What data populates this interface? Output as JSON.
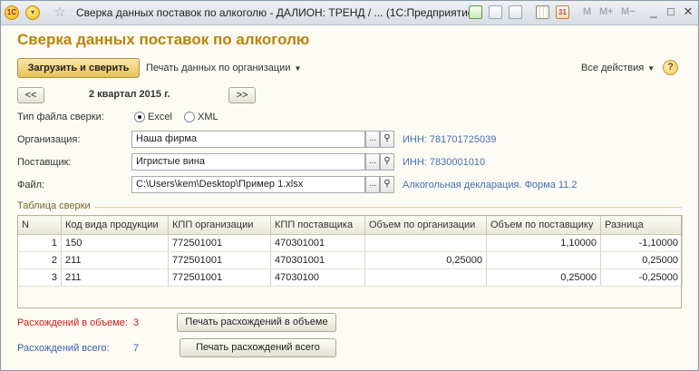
{
  "titlebar": {
    "title": "Сверка данных поставок по алкоголю - ДАЛИОН: ТРЕНД / ... (1С:Предприятие)",
    "logo": "1С",
    "m_labels": [
      "M",
      "M+",
      "M−"
    ]
  },
  "form": {
    "title": "Сверка данных поставок по алкоголю",
    "load_button": "Загрузить и сверить",
    "print_org_menu": "Печать данных по организации",
    "all_actions": "Все действия",
    "help": "?",
    "period": "2 квартал 2015 г.",
    "prev": "<<",
    "next": ">>"
  },
  "fields": {
    "file_type_label": "Тип файла сверки:",
    "radio_excel": "Excel",
    "radio_xml": "XML",
    "org_label": "Организация:",
    "org_value": "Наша фирма",
    "org_inn": "ИНН: 781701725039",
    "supplier_label": "Поставщик:",
    "supplier_value": "Игристые вина",
    "supplier_inn": "ИНН: 7830001010",
    "file_label": "Файл:",
    "file_value": "C:\\Users\\kem\\Desktop\\Пример 1.xlsx",
    "file_link": "Алкогольная декларация. Форма 11.2",
    "dots": "...",
    "magnifier": "🔍"
  },
  "table": {
    "group_title": "Таблица сверки",
    "columns": [
      "N",
      "Код вида продукции",
      "КПП организации",
      "КПП поставщика",
      "Объем по организации",
      "Объем по поставщику",
      "Разница"
    ],
    "rows": [
      [
        "1",
        "150",
        "772501001",
        "470301001",
        "",
        "1,10000",
        "-1,10000"
      ],
      [
        "2",
        "211",
        "772501001",
        "470301001",
        "0,25000",
        "",
        "0,25000"
      ],
      [
        "3",
        "211",
        "772501001",
        "47030100",
        "",
        "0,25000",
        "-0,25000"
      ]
    ]
  },
  "footer": {
    "volume_diff_label": "Расхождений в объеме:",
    "volume_diff_count": "3",
    "volume_diff_button": "Печать расхождений в объеме",
    "total_diff_label": "Расхождений всего:",
    "total_diff_count": "7",
    "total_diff_button": "Печать расхождений всего"
  }
}
